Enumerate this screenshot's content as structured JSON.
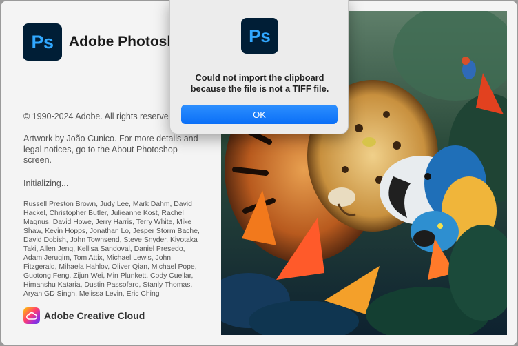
{
  "app": {
    "logo_text": "Ps",
    "title": "Adobe Photoshop",
    "copyright": "© 1990-2024 Adobe. All rights reserved.",
    "artwork_credit": "Artwork by João Cunico. For more details and legal notices, go to the About Photoshop screen.",
    "status": "Initializing...",
    "credits": "Russell Preston Brown, Judy Lee, Mark Dahm, David Hackel, Christopher Butler, Julieanne Kost, Rachel Magnus, David Howe, Jerry Harris, Terry White, Mike Shaw, Kevin Hopps, Jonathan Lo, Jesper Storm Bache, David Dobish, John Townsend, Steve Snyder, Kiyotaka Taki, Allen Jeng, Kellisa Sandoval, Daniel Presedo, Adam Jerugim, Tom Attix, Michael Lewis, John Fitzgerald, Mihaela Hahlov, Oliver Qian, Michael Pope, Guotong Feng, Zijun Wei, Min Plunkett, Cody Cuellar, Himanshu Kataria, Dustin Passofaro, Stanly Thomas, Aryan GD Singh, Melissa Levin, Eric Ching",
    "creative_cloud_label": "Adobe Creative Cloud"
  },
  "dialog": {
    "icon_text": "Ps",
    "message_line1": "Could not import the clipboard",
    "message_line2": "because the file is not a TIFF file.",
    "ok_label": "OK"
  },
  "colors": {
    "ps_bg": "#001e36",
    "ps_blue": "#31a8ff",
    "ok_button": "#0a6ff7"
  }
}
